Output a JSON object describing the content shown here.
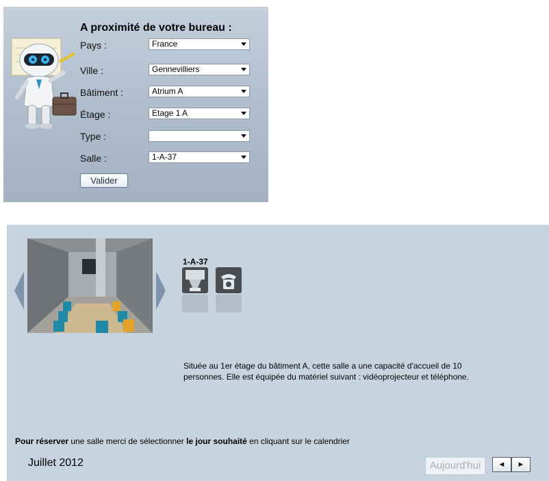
{
  "finder": {
    "title": "A proximité de votre bureau :",
    "fields": [
      {
        "label": "Pays :",
        "value": "France"
      },
      {
        "label": "Ville :",
        "value": "Gennevilliers"
      },
      {
        "label": "Bâtiment :",
        "value": "Atrium A"
      },
      {
        "label": "Étage :",
        "value": "Etage 1 A"
      },
      {
        "label": "Type :",
        "value": ""
      },
      {
        "label": "Salle :",
        "value": "1-A-37"
      }
    ],
    "submit_label": "Valider"
  },
  "room": {
    "name": "1-A-37",
    "equipment_icons": [
      "projector-icon",
      "telephone-icon"
    ],
    "description": "Située au 1er étage du bâtiment A, cette salle a une capacité d'accueil de 10 personnes. Elle est équipée du matériel suivant : vidéoprojecteur et téléphone."
  },
  "reserve": {
    "prefix_bold": "Pour réserver",
    "middle": " une salle merci de sélectionner ",
    "day_bold": "le jour souhaité",
    "suffix": " en cliquant sur le calendrier"
  },
  "calendar": {
    "month_label": "Juillet 2012",
    "today_label": "Aujourd'hui",
    "prev_label": "◄",
    "next_label": "►"
  },
  "colors": {
    "finder_bg": "#aebccc",
    "room_bg": "#c8d3e0",
    "arrow": "#7f93ad"
  }
}
